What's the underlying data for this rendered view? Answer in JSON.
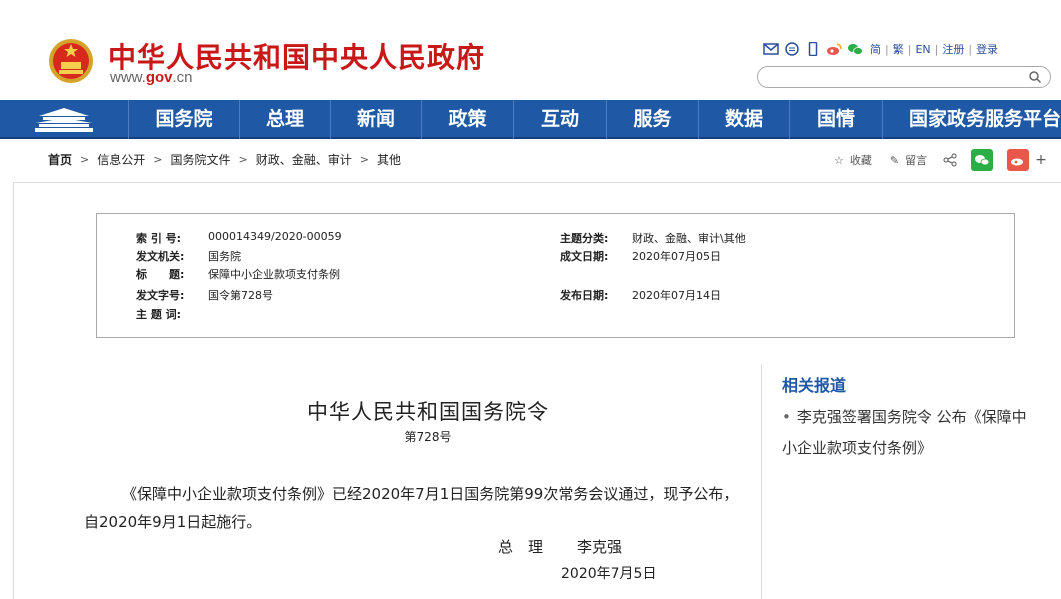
{
  "site": {
    "title": "中华人民共和国中央人民政府",
    "url_prefix": "www.",
    "url_gov": "gov",
    "url_suffix": ".cn"
  },
  "tools": {
    "icons": [
      "mail-icon",
      "message-icon",
      "mobile-icon",
      "weibo-icon",
      "wechat-icon"
    ],
    "langs": [
      "简",
      "繁",
      "EN",
      "注册",
      "登录"
    ]
  },
  "search": {
    "placeholder": ""
  },
  "nav": {
    "items": [
      "国务院",
      "总理",
      "新闻",
      "政策",
      "互动",
      "服务",
      "数据",
      "国情",
      "国家政务服务平台"
    ]
  },
  "breadcrumb": {
    "items": [
      "首页",
      "信息公开",
      "国务院文件",
      "财政、金融、审计",
      "其他"
    ],
    "sep": ">"
  },
  "share": {
    "collect": "收藏",
    "comment": "留言"
  },
  "meta": {
    "index_label": "索 引 号:",
    "index_value": "000014349/2020-00059",
    "category_label": "主题分类:",
    "category_value": "财政、金融、审计\\其他",
    "issuer_label": "发文机关:",
    "issuer_value": "国务院",
    "created_label": "成文日期:",
    "created_value": "2020年07月05日",
    "title_label": "标　　题:",
    "title_value": "保障中小企业款项支付条例",
    "doc_no_label": "发文字号:",
    "doc_no_value": "国令第728号",
    "published_label": "发布日期:",
    "published_value": "2020年07月14日",
    "keywords_label": "主 题 词:",
    "keywords_value": ""
  },
  "document": {
    "title": "中华人民共和国国务院令",
    "number": "第728号",
    "body": "《保障中小企业款项支付条例》已经2020年7月1日国务院第99次常务会议通过，现予公布，自2020年9月1日起施行。",
    "sign_title": "总　理",
    "sign_name": "李克强",
    "sign_date": "2020年7月5日"
  },
  "related": {
    "title": "相关报道",
    "items": [
      "李克强签署国务院令 公布《保障中小企业款项支付条例》"
    ]
  },
  "colors": {
    "brand_red": "#c81818",
    "nav_blue": "#1f59a5"
  }
}
